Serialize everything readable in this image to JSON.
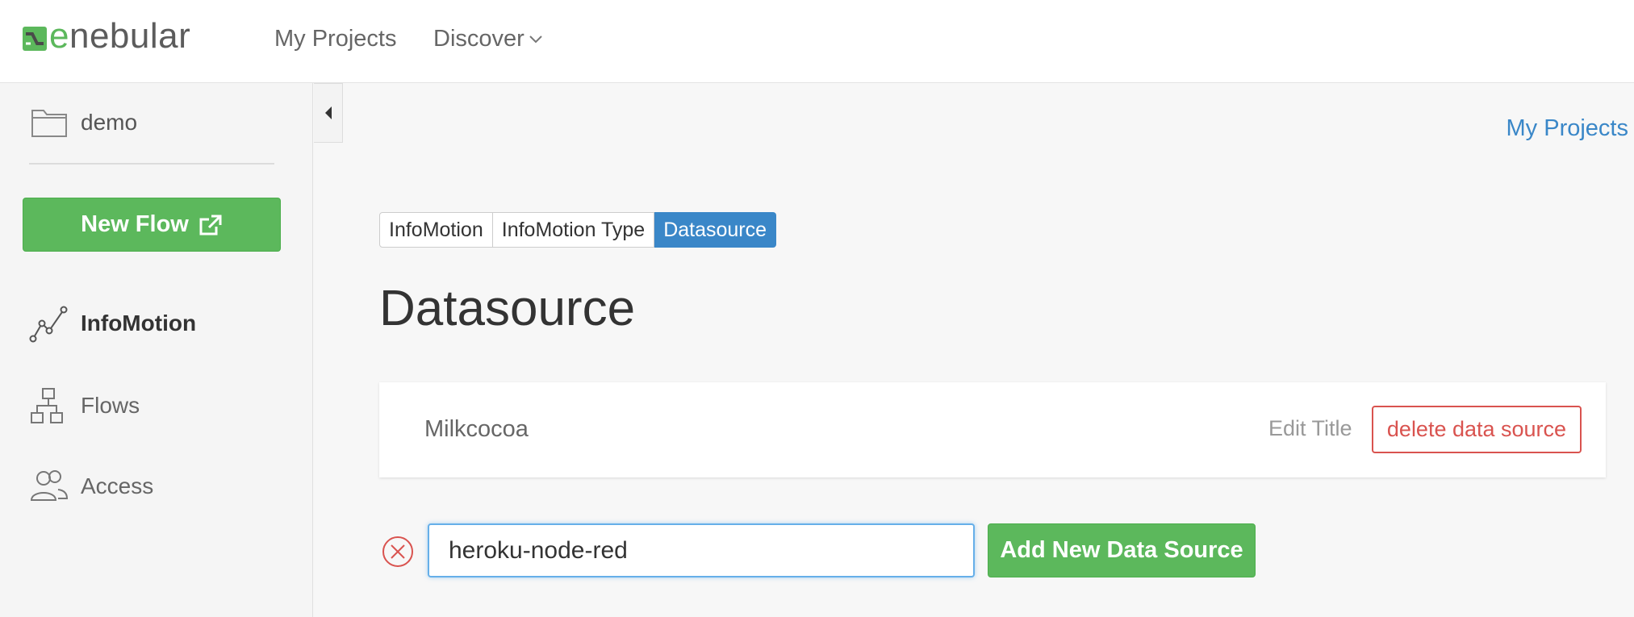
{
  "header": {
    "logo_text": "enebular",
    "nav": {
      "my_projects": "My Projects",
      "discover": "Discover"
    }
  },
  "sidebar": {
    "project_name": "demo",
    "new_flow_label": "New Flow",
    "items": [
      {
        "label": "InfoMotion",
        "icon": "line-chart-icon",
        "active": true
      },
      {
        "label": "Flows",
        "icon": "flow-tree-icon",
        "active": false
      },
      {
        "label": "Access",
        "icon": "users-icon",
        "active": false
      }
    ]
  },
  "main": {
    "breadcrumb": "My Projects",
    "tabs": [
      {
        "label": "InfoMotion",
        "active": false
      },
      {
        "label": "InfoMotion Type",
        "active": false
      },
      {
        "label": "Datasource",
        "active": true
      }
    ],
    "title": "Datasource",
    "datasource_card": {
      "name": "Milkcocoa",
      "edit_label": "Edit Title",
      "delete_label": "delete data source"
    },
    "new_datasource": {
      "input_value": "heroku-node-red",
      "add_label": "Add New Data Source"
    }
  },
  "colors": {
    "brand_green": "#5cb85c",
    "accent_blue": "#3a87c8",
    "danger_red": "#d9534f"
  }
}
